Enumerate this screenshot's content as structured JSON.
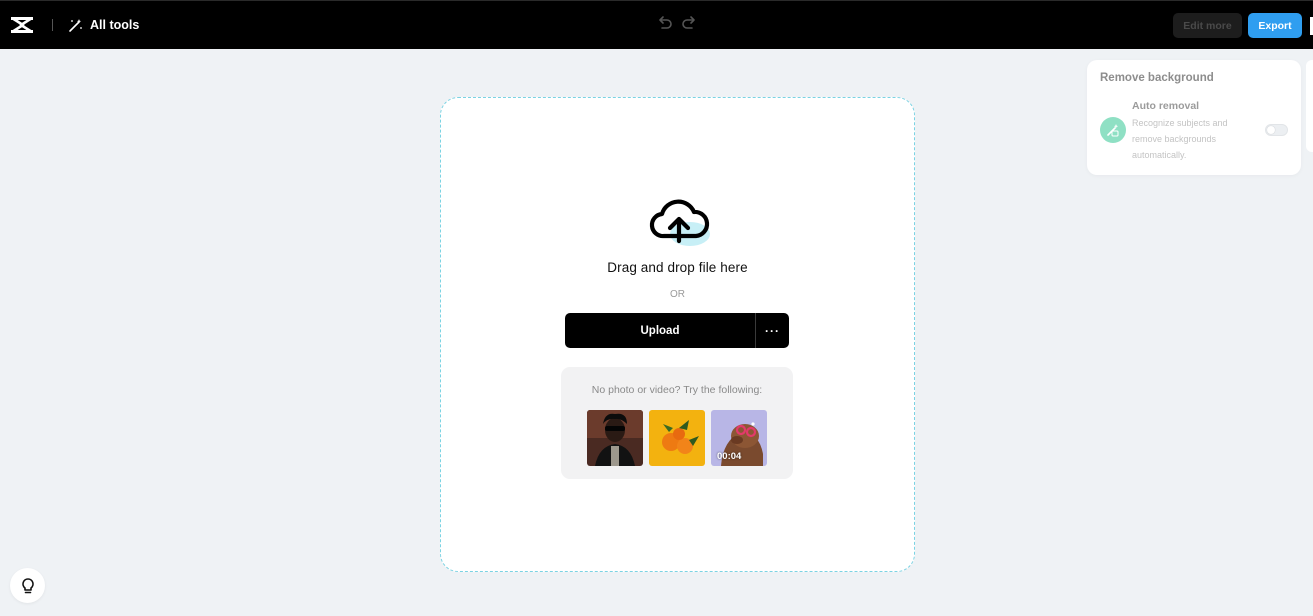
{
  "topbar": {
    "logo_icon": "capcut-logo-icon",
    "all_tools_label": "All tools",
    "undo_icon": "undo-icon",
    "redo_icon": "redo-icon",
    "edit_more_label": "Edit more",
    "export_label": "Export"
  },
  "upload": {
    "drag_text": "Drag and drop file here",
    "or_text": "OR",
    "upload_label": "Upload",
    "more_label": "···",
    "samples_prompt": "No photo or video? Try the following:",
    "samples": [
      {
        "name": "sample-portrait-image"
      },
      {
        "name": "sample-oranges-image"
      },
      {
        "name": "sample-dog-video",
        "duration": "00:04"
      }
    ]
  },
  "panel": {
    "title": "Remove background",
    "auto_title": "Auto removal",
    "auto_desc": "Recognize subjects and remove backgrounds automatically.",
    "toggle_on": false
  },
  "colors": {
    "topbar_bg": "#000000",
    "accent": "#2f9ef0",
    "dropzone_border": "#7bd3e3"
  }
}
